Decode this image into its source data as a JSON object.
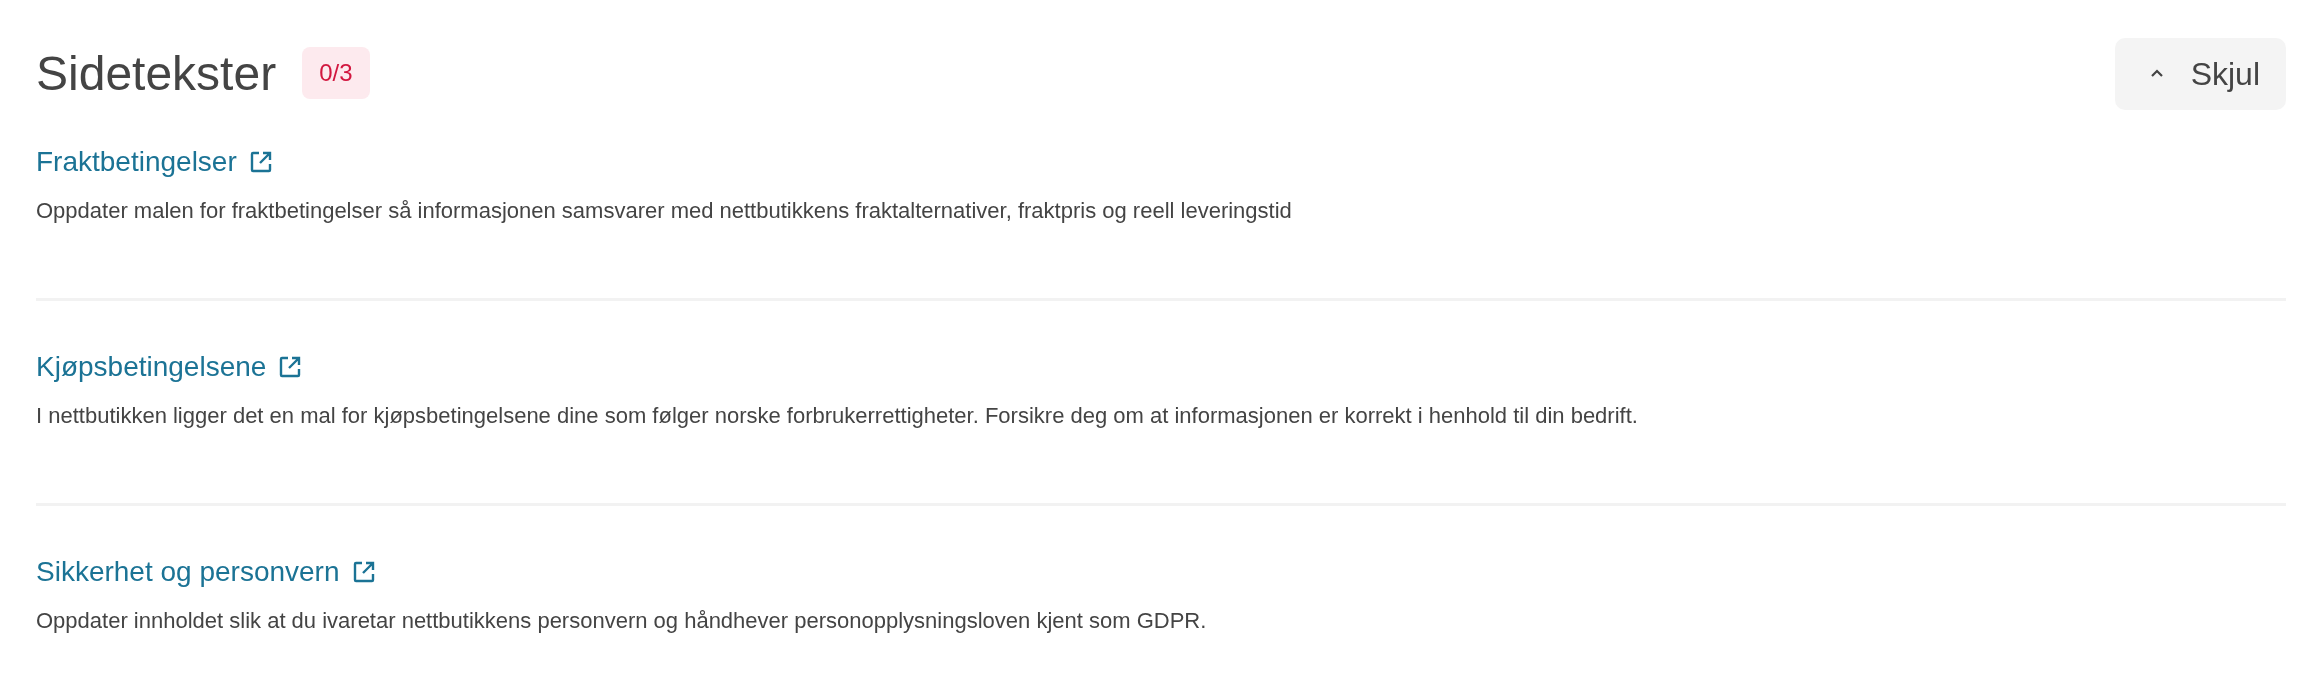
{
  "header": {
    "title": "Sidetekster",
    "badge": "0/3",
    "toggle_button": {
      "label": "Skjul",
      "expanded": true
    }
  },
  "items": [
    {
      "link": "Fraktbetingelser",
      "description": "Oppdater malen for fraktbetingelser så informasjonen samsvarer med nettbutikkens fraktalternativer, fraktpris og reell leveringstid"
    },
    {
      "link": "Kjøpsbetingelsene",
      "description": "I nettbutikken ligger det en mal for kjøpsbetingelsene dine som følger norske forbrukerrettigheter. Forsikre deg om at informasjonen er korrekt i henhold til din bedrift."
    },
    {
      "link": "Sikkerhet og personvern",
      "description": "Oppdater innholdet slik at du ivaretar nettbutikkens personvern og håndhever personopplysningsloven kjent som GDPR."
    }
  ]
}
